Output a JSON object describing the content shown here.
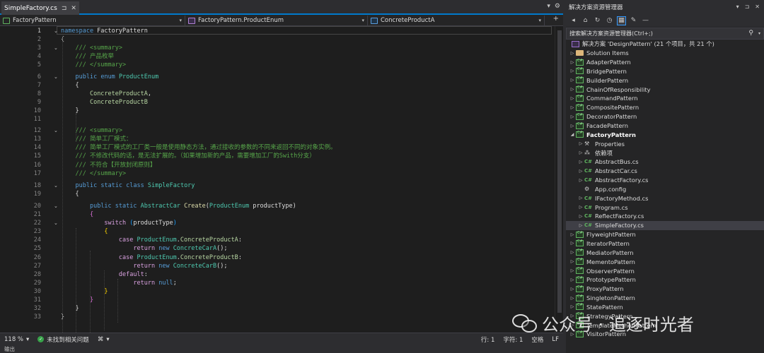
{
  "editor": {
    "tab": {
      "title": "SimpleFactory.cs",
      "pin": "⊐",
      "close": "✕"
    },
    "tabbar_right": {
      "dropdown": "▾",
      "settings": "⚙"
    },
    "nav": {
      "project": "FactoryPattern",
      "type": "FactoryPattern.ProductEnum",
      "member": "ConcreteProductA",
      "add": "+"
    },
    "lines": [
      {
        "n": "1",
        "html": "<span class='kw'>namespace</span> FactoryPattern"
      },
      {
        "n": "2",
        "html": "{"
      },
      {
        "n": "3",
        "html": "    <span class='cmt'>/// &lt;summary&gt;</span>"
      },
      {
        "n": "4",
        "html": "    <span class='cmt'>/// 产品枚举</span>"
      },
      {
        "n": "5",
        "html": "    <span class='cmt'>/// &lt;/summary&gt;</span>"
      },
      {
        "n": "6",
        "html": "    <span class='kw'>public</span> <span class='kw'>enum</span> <span class='cls'>ProductEnum</span>"
      },
      {
        "n": "7",
        "html": "    {"
      },
      {
        "n": "8",
        "html": "        <span class='enumv'>ConcreteProductA</span>,"
      },
      {
        "n": "9",
        "html": "        <span class='enumv'>ConcreteProductB</span>"
      },
      {
        "n": "10",
        "html": "    }"
      },
      {
        "n": "11",
        "html": ""
      },
      {
        "n": "12",
        "html": "    <span class='cmt'>/// &lt;summary&gt;</span>"
      },
      {
        "n": "13",
        "html": "    <span class='cmt'>/// 简单工厂模式：</span>"
      },
      {
        "n": "14",
        "html": "    <span class='cmt'>/// 简单工厂模式的工厂类一般是使用静态方法，通过接收的参数的不同来返回不同的对象实例。</span>"
      },
      {
        "n": "15",
        "html": "    <span class='cmt'>/// 不修改代码的话，是无法扩展的。（如果增加新的产品，需要增加工厂的Swith分支）</span>"
      },
      {
        "n": "16",
        "html": "    <span class='cmt'>/// 不符合【开放封闭原则】</span>"
      },
      {
        "n": "17",
        "html": "    <span class='cmt'>/// &lt;/summary&gt;</span>"
      },
      {
        "n": "18",
        "html": "    <span class='kw'>public</span> <span class='kw'>static</span> <span class='kw'>class</span> <span class='cls'>SimpleFactory</span>"
      },
      {
        "n": "19",
        "html": "    {"
      },
      {
        "n": "20",
        "html": "        <span class='kw'>public</span> <span class='kw'>static</span> <span class='cls'>AbstractCar</span> <span class='fn'>Create</span>(<span class='cls'>ProductEnum</span> productType)"
      },
      {
        "n": "21",
        "html": "        <span class='brk2'>{</span>"
      },
      {
        "n": "22",
        "html": "            <span class='ctrl'>switch</span> <span class='brk3'>(</span>productType<span class='brk3'>)</span>"
      },
      {
        "n": "23",
        "html": "            <span class='brk'>{</span>"
      },
      {
        "n": "24",
        "html": "                <span class='ctrl'>case</span> <span class='cls'>ProductEnum</span>.<span class='enumv'>ConcreteProductA</span>:"
      },
      {
        "n": "25",
        "html": "                    <span class='ctrl'>return</span> <span class='kw'>new</span> <span class='cls'>ConcreteCarA</span>();"
      },
      {
        "n": "26",
        "html": "                <span class='ctrl'>case</span> <span class='cls'>ProductEnum</span>.<span class='enumv'>ConcreteProductB</span>:"
      },
      {
        "n": "27",
        "html": "                    <span class='ctrl'>return</span> <span class='kw'>new</span> <span class='cls'>ConcreteCarB</span>();"
      },
      {
        "n": "28",
        "html": "                <span class='ctrl'>default</span>:"
      },
      {
        "n": "29",
        "html": "                    <span class='ctrl'>return</span> <span class='kw'>null</span>;"
      },
      {
        "n": "30",
        "html": "            <span class='brk'>}</span>"
      },
      {
        "n": "31",
        "html": "        <span class='brk2'>}</span>"
      },
      {
        "n": "32",
        "html": "    }"
      },
      {
        "n": "33",
        "html": "}"
      }
    ],
    "status": {
      "zoom": "118 %",
      "issues": "未找到相关问题",
      "line": "行: 1",
      "char": "字符: 1",
      "spaces": "空格",
      "eol": "LF"
    },
    "bottom_panel": "输出"
  },
  "solution_explorer": {
    "title": "解决方案资源管理器",
    "title_icons": {
      "dropdown": "▾",
      "pin": "⊐",
      "close": "✕"
    },
    "search_placeholder": "搜索解决方案资源管理器(Ctrl+;)",
    "search_icon": "⚲",
    "root": "解决方案 'DesignPattern' (21 个项目，共 21 个)",
    "items": [
      {
        "label": "Solution Items",
        "icon": "folder",
        "arrow": "▷",
        "level": 1
      },
      {
        "label": "AdapterPattern",
        "icon": "proj",
        "arrow": "▷",
        "level": 1
      },
      {
        "label": "BridgePattern",
        "icon": "proj",
        "arrow": "▷",
        "level": 1
      },
      {
        "label": "BuilderPattern",
        "icon": "proj",
        "arrow": "▷",
        "level": 1
      },
      {
        "label": "ChainOfResponsibility",
        "icon": "proj",
        "arrow": "▷",
        "level": 1
      },
      {
        "label": "CommandPattern",
        "icon": "proj",
        "arrow": "▷",
        "level": 1
      },
      {
        "label": "CompositePattern",
        "icon": "proj",
        "arrow": "▷",
        "level": 1
      },
      {
        "label": "DecoratorPattern",
        "icon": "proj",
        "arrow": "▷",
        "level": 1
      },
      {
        "label": "FacadePattern",
        "icon": "proj",
        "arrow": "▷",
        "level": 1
      },
      {
        "label": "FactoryPattern",
        "icon": "proj",
        "arrow": "◢",
        "level": 1,
        "bold": true
      },
      {
        "label": "Properties",
        "icon": "wrench",
        "arrow": "▷",
        "level": 2
      },
      {
        "label": "依赖项",
        "icon": "deps",
        "arrow": "▷",
        "level": 2
      },
      {
        "label": "AbstractBus.cs",
        "icon": "cs",
        "arrow": "▷",
        "level": 2
      },
      {
        "label": "AbstractCar.cs",
        "icon": "cs",
        "arrow": "▷",
        "level": 2
      },
      {
        "label": "AbstractFactory.cs",
        "icon": "cs",
        "arrow": "▷",
        "level": 2
      },
      {
        "label": "App.config",
        "icon": "config",
        "arrow": "",
        "level": 2
      },
      {
        "label": "IFactoryMethod.cs",
        "icon": "cs",
        "arrow": "▷",
        "level": 2
      },
      {
        "label": "Program.cs",
        "icon": "cs",
        "arrow": "▷",
        "level": 2
      },
      {
        "label": "ReflectFactory.cs",
        "icon": "cs",
        "arrow": "▷",
        "level": 2
      },
      {
        "label": "SimpleFactory.cs",
        "icon": "cs",
        "arrow": "▷",
        "level": 2,
        "selected": true
      },
      {
        "label": "FlyweightPattern",
        "icon": "proj",
        "arrow": "▷",
        "level": 1
      },
      {
        "label": "IteratorPattern",
        "icon": "proj",
        "arrow": "▷",
        "level": 1
      },
      {
        "label": "MediatorPattern",
        "icon": "proj",
        "arrow": "▷",
        "level": 1
      },
      {
        "label": "MementoPattern",
        "icon": "proj",
        "arrow": "▷",
        "level": 1
      },
      {
        "label": "ObserverPattern",
        "icon": "proj",
        "arrow": "▷",
        "level": 1
      },
      {
        "label": "PrototypePattern",
        "icon": "proj",
        "arrow": "▷",
        "level": 1
      },
      {
        "label": "ProxyPattern",
        "icon": "proj",
        "arrow": "▷",
        "level": 1
      },
      {
        "label": "SingletonPattern",
        "icon": "proj",
        "arrow": "▷",
        "level": 1
      },
      {
        "label": "StatePattern",
        "icon": "proj",
        "arrow": "▷",
        "level": 1
      },
      {
        "label": "StrategyPattern",
        "icon": "proj",
        "arrow": "▷",
        "level": 1
      },
      {
        "label": "TemplateMethodPattern",
        "icon": "proj",
        "arrow": "▷",
        "level": 1
      },
      {
        "label": "VisitorPattern",
        "icon": "proj",
        "arrow": "▷",
        "level": 1
      }
    ]
  },
  "watermark": {
    "text": "公众号 · 追逐时光者"
  },
  "colors": {
    "accent": "#007acc",
    "keyword": "#569cd6",
    "type": "#4ec9b0",
    "comment": "#57a64a",
    "control": "#d8a0df"
  }
}
